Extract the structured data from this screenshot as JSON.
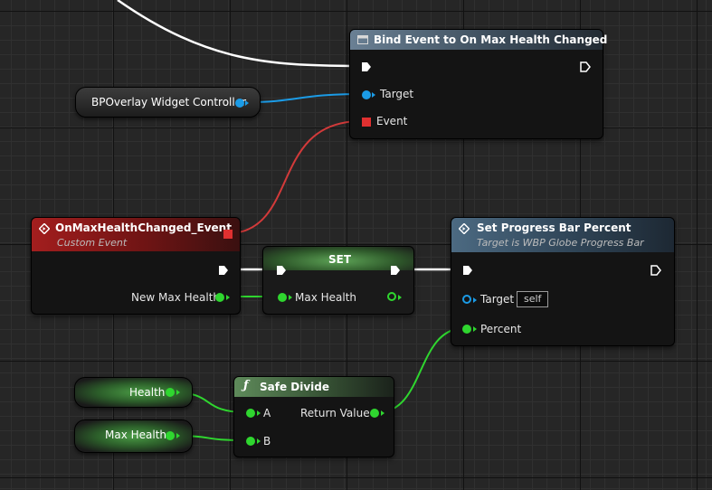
{
  "bind_node": {
    "title": "Bind Event to On Max Health Changed",
    "target_label": "Target",
    "event_label": "Event"
  },
  "controller_var": {
    "label": "BPOverlay Widget Controller"
  },
  "event_node": {
    "title": "OnMaxHealthChanged_Event",
    "subtitle": "Custom Event",
    "output_label": "New Max Health"
  },
  "set_node": {
    "title": "SET",
    "input_label": "Max Health"
  },
  "progress_node": {
    "title": "Set Progress Bar Percent",
    "subtitle": "Target is WBP Globe Progress Bar",
    "target_label": "Target",
    "target_value": "self",
    "percent_label": "Percent"
  },
  "health_var": {
    "label": "Health"
  },
  "maxhealth_var": {
    "label": "Max Health"
  },
  "divide_node": {
    "title": "Safe Divide",
    "a_label": "A",
    "b_label": "B",
    "return_label": "Return Value"
  },
  "colors": {
    "exec": "#ffffff",
    "object": "#1b9be6",
    "float": "#2fd62f",
    "delegate": "#e03030",
    "event_header": "#8b1a1a",
    "set_header": "#3f7a3a",
    "bind_header": "#5a6f80",
    "progress_header": "#3d5669"
  }
}
